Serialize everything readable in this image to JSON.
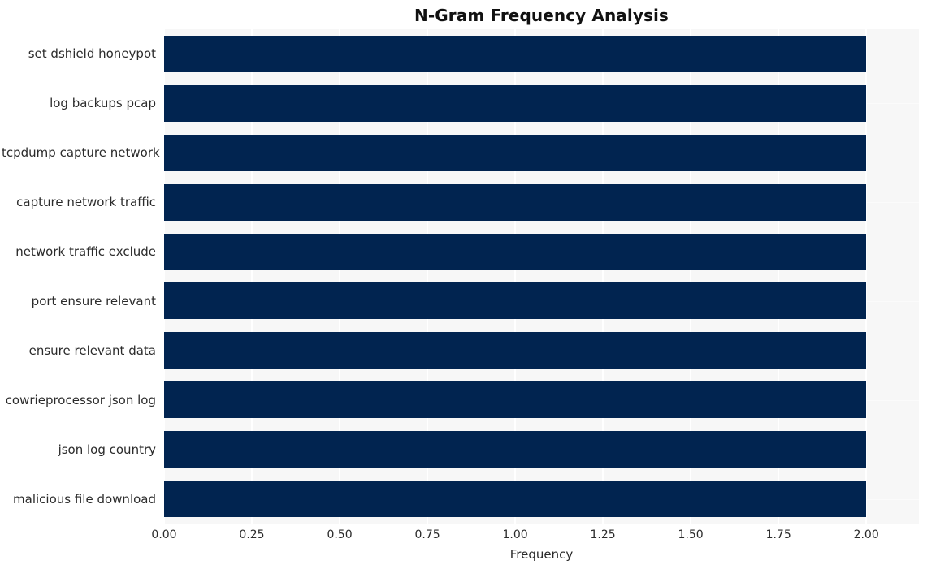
{
  "chart_data": {
    "type": "bar",
    "orientation": "horizontal",
    "title": "N-Gram Frequency Analysis",
    "xlabel": "Frequency",
    "ylabel": "",
    "categories": [
      "set dshield honeypot",
      "log backups pcap",
      "tcpdump capture network",
      "capture network traffic",
      "network traffic exclude",
      "port ensure relevant",
      "ensure relevant data",
      "cowrieprocessor json log",
      "json log country",
      "malicious file download"
    ],
    "values": [
      2.0,
      2.0,
      2.0,
      2.0,
      2.0,
      2.0,
      2.0,
      2.0,
      2.0,
      2.0
    ],
    "xlim": [
      0.0,
      2.15
    ],
    "xticks": [
      "0.00",
      "0.25",
      "0.50",
      "0.75",
      "1.00",
      "1.25",
      "1.50",
      "1.75",
      "2.00"
    ],
    "xtick_values": [
      0.0,
      0.25,
      0.5,
      0.75,
      1.0,
      1.25,
      1.5,
      1.75,
      2.0
    ],
    "grid": true,
    "legend": "none",
    "bar_color": "#012450",
    "plot_background": "#f7f7f7",
    "figure_background": "#ffffff",
    "text_color": "#2b2b2b",
    "title_color": "#111111"
  }
}
